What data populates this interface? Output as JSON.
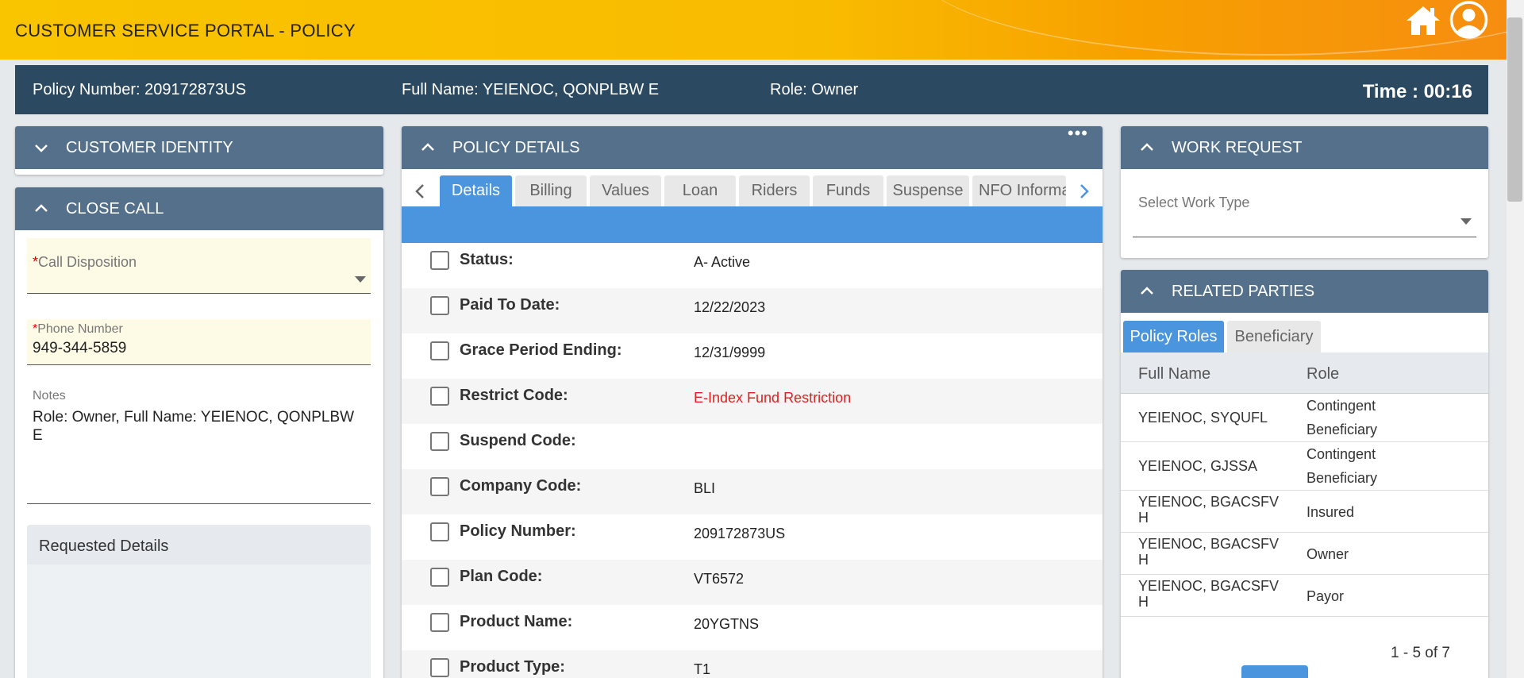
{
  "header": {
    "title": "CUSTOMER SERVICE PORTAL - POLICY",
    "icons": [
      "home-icon",
      "user-icon"
    ]
  },
  "info_bar": {
    "policy_number": "Policy Number: 209172873US",
    "full_name": "Full Name: YEIENOC, QONPLBW E",
    "role": "Role: Owner",
    "time": "Time : 00:16"
  },
  "customer_identity": {
    "title": "CUSTOMER IDENTITY"
  },
  "close_call": {
    "title": "CLOSE CALL",
    "call_disposition": {
      "required_mark": "*",
      "label": "Call Disposition",
      "value": ""
    },
    "phone_number": {
      "required_mark": "*",
      "label": "Phone Number",
      "value": "949-344-5859"
    },
    "notes": {
      "label": "Notes",
      "value": "Role: Owner, Full Name: YEIENOC, QONPLBW E"
    },
    "requested_details": {
      "title": "Requested Details"
    }
  },
  "policy_details": {
    "title": "POLICY DETAILS",
    "more_label": "•••",
    "tabs": [
      {
        "label": "Details",
        "active": true
      },
      {
        "label": "Billing"
      },
      {
        "label": "Values"
      },
      {
        "label": "Loan"
      },
      {
        "label": "Riders"
      },
      {
        "label": "Funds"
      },
      {
        "label": "Suspense"
      },
      {
        "label": "NFO Informa"
      }
    ],
    "rows": [
      {
        "label": "Status:",
        "value": "A- Active"
      },
      {
        "label": "Paid To Date:",
        "value": "12/22/2023"
      },
      {
        "label": "Grace Period Ending:",
        "value": "12/31/9999"
      },
      {
        "label": "Restrict Code:",
        "value": "E-Index Fund Restriction",
        "warning": true
      },
      {
        "label": "Suspend Code:",
        "value": ""
      },
      {
        "label": "Company Code:",
        "value": "BLI"
      },
      {
        "label": "Policy Number:",
        "value": "209172873US"
      },
      {
        "label": "Plan Code:",
        "value": "VT6572"
      },
      {
        "label": "Product Name:",
        "value": "20YGTNS"
      },
      {
        "label": "Product Type:",
        "value": "T1"
      }
    ]
  },
  "work_request": {
    "title": "WORK REQUEST",
    "select_label": "Select Work Type"
  },
  "related_parties": {
    "title": "RELATED PARTIES",
    "tabs": [
      {
        "label": "Policy Roles",
        "active": true
      },
      {
        "label": "Beneficiary"
      }
    ],
    "columns": [
      "Full Name",
      "Role"
    ],
    "rows": [
      {
        "name": "YEIENOC, SYQUFL",
        "role_lines": [
          "Contingent",
          "Beneficiary"
        ]
      },
      {
        "name": "YEIENOC, GJSSA",
        "role_lines": [
          "Contingent",
          "Beneficiary"
        ]
      },
      {
        "name_lines": [
          "YEIENOC, BGACSFV",
          "H"
        ],
        "role": "Insured"
      },
      {
        "name_lines": [
          "YEIENOC, BGACSFV",
          "H"
        ],
        "role": "Owner"
      },
      {
        "name_lines": [
          "YEIENOC, BGACSFV",
          "H"
        ],
        "role": "Payor"
      }
    ],
    "pagination": "1 - 5 of 7"
  },
  "colors": {
    "header_yellow": "#f9c400",
    "header_orange": "#f68d10",
    "info_bar": "#2b4a61",
    "panel_header": "#54708a",
    "active_tab": "#4a95de",
    "warning_text": "#e02020",
    "required_field_bg": "#fdfbe6"
  }
}
